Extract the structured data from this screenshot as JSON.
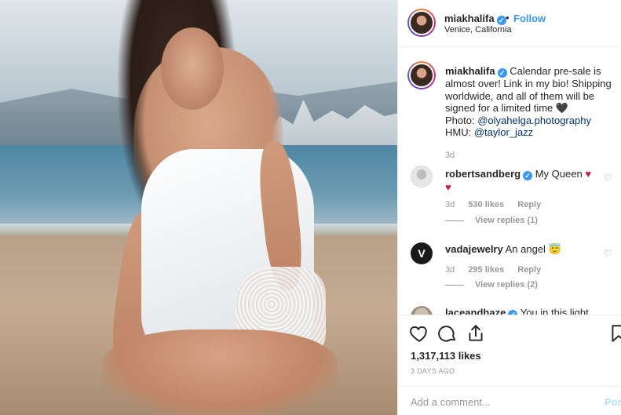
{
  "header": {
    "username": "miakhalifa",
    "separator": "•",
    "follow_label": "Follow",
    "location": "Venice, California"
  },
  "caption": {
    "username": "miakhalifa",
    "text_before_links": "Calendar pre-sale is almost over! Link in my bio! Shipping worldwide, and all of them will be signed for a limited time 🖤",
    "photo_prefix": "Photo: ",
    "photo_handle": "@olyahelga.photography",
    "hmu_prefix": "HMU: ",
    "hmu_handle": "@taylor_jazz",
    "time": "3d"
  },
  "comments": [
    {
      "username": "robertsandberg",
      "verified": true,
      "text": "My Queen",
      "emoji": "♥ ♥",
      "time": "3d",
      "likes": "530 likes",
      "reply_label": "Reply",
      "view_replies": "View replies (1)"
    },
    {
      "username": "vadajewelry",
      "verified": false,
      "avatar_letter": "V",
      "text": "An angel 😇",
      "time": "3d",
      "likes": "295 likes",
      "reply_label": "Reply",
      "view_replies": "View replies (2)"
    },
    {
      "username": "laceandhaze",
      "verified": true,
      "text": "You in this light"
    }
  ],
  "actions": {
    "like_count": "1,317,113 likes",
    "time_ago": "3 DAYS AGO",
    "add_comment_placeholder": "Add a comment...",
    "post_label": "Post"
  },
  "colors": {
    "accent": "#3897f0",
    "heart": "#c2203a",
    "muted": "#999999",
    "text": "#262626"
  }
}
